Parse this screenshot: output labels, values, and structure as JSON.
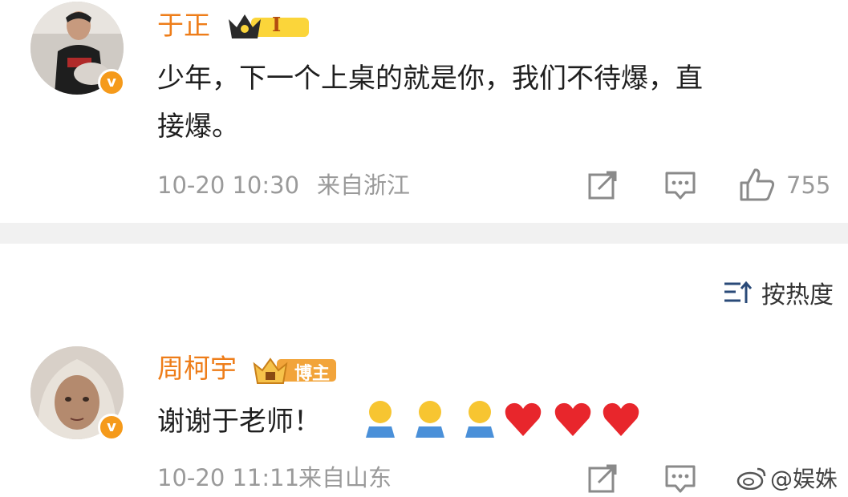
{
  "comments": [
    {
      "user": "于正",
      "level": "I",
      "text_line1": "少年，下一个上桌的就是你，我们不待爆，直",
      "text_line2": "接爆。",
      "time": "10-20 10:30",
      "location": "来自浙江",
      "likes": "755"
    },
    {
      "user": "周柯宇",
      "badge": "博主",
      "text": "谢谢于老师！",
      "time": "10-20 11:11",
      "location": "来自山东"
    }
  ],
  "sort": {
    "label": "按热度"
  },
  "verified_mark": "v",
  "watermark": "@娱姝",
  "colors": {
    "name": "#ee7d19",
    "meta": "#9a9a9a",
    "verified": "#f59a1b",
    "heart": "#e8262c"
  }
}
